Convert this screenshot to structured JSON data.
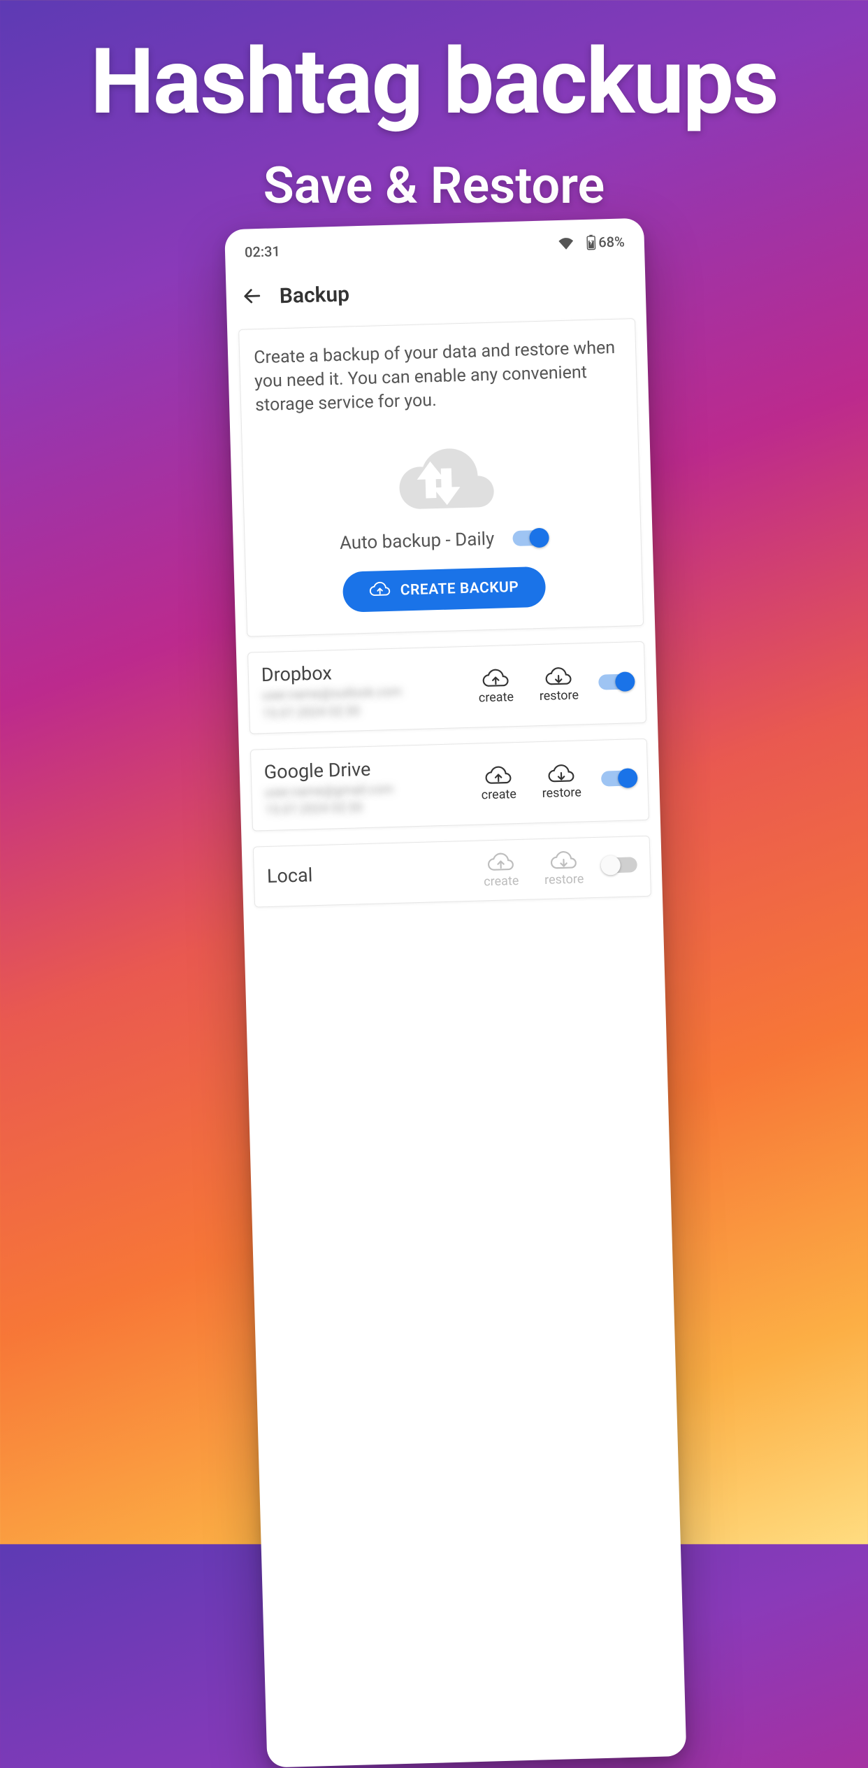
{
  "marketing": {
    "title": "Hashtag backups",
    "subtitle": "Save & Restore"
  },
  "status": {
    "time": "02:31",
    "battery": "68%"
  },
  "appbar": {
    "title": "Backup"
  },
  "hero": {
    "description": "Create a backup of your data and restore when you need it. You can enable any convenient storage service for you.",
    "auto_label": "Auto backup - Daily",
    "auto_enabled": true,
    "create_label": "CREATE BACKUP"
  },
  "action_labels": {
    "create": "create",
    "restore": "restore"
  },
  "services": [
    {
      "name": "Dropbox",
      "enabled": true,
      "sub1": "user.name@outlook.com",
      "sub2": "15.07.2024 02:30"
    },
    {
      "name": "Google Drive",
      "enabled": true,
      "sub1": "user.name@gmail.com",
      "sub2": "15.07.2024 02:30"
    },
    {
      "name": "Local",
      "enabled": false,
      "sub1": "",
      "sub2": ""
    }
  ]
}
